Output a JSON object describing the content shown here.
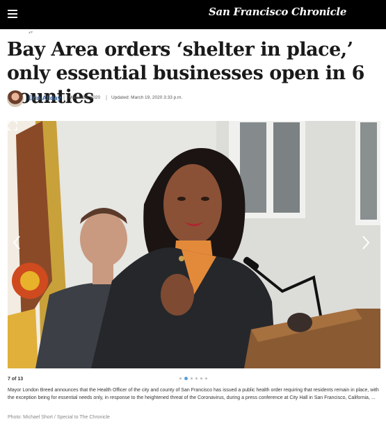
{
  "header": {
    "masthead": "San Francisco Chronicle",
    "menu_icon": "hamburger-menu-icon",
    "background": "#000000"
  },
  "article": {
    "headline": "Bay Area orders ‘shelter in place,’ only essential businesses open in 6 counties",
    "author": "Erin Allday",
    "published": "March 16, 2020",
    "updated": "Updated: March 19, 2020 3:33 p.m."
  },
  "gallery": {
    "counter": "7 of 13",
    "current_index": 7,
    "dot_count": 6,
    "active_dot": 2,
    "caption": "Mayor London Breed announces that the Health Officer of the city and county of San Francisco has issued a public health order requiring that residents remain in place, with the exception being for essential needs only, in response to the heightened threat of the Coronavirus, during a press conference at City Hall in San Francisco, California, ...",
    "credit": "Photo: Michael Short / Special to The Chronicle",
    "icons": [
      "chevron-left-icon",
      "chevron-right-icon",
      "expand-icon"
    ]
  },
  "colors": {
    "author_link": "#3a6aa6",
    "dot_active": "#5aa0d8"
  }
}
